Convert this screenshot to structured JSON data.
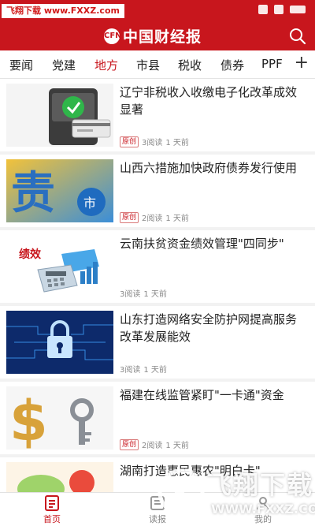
{
  "watermark": {
    "top_left": "飞翔下载 www.FXXZ.com",
    "brand": "飞翔下载",
    "domain": "WWW.FXXZ.COM"
  },
  "header": {
    "title": "中国财经报",
    "logo_mark": "CFN"
  },
  "tabs": [
    {
      "label": "要闻"
    },
    {
      "label": "党建"
    },
    {
      "label": "地方",
      "active": true
    },
    {
      "label": "市县"
    },
    {
      "label": "税收"
    },
    {
      "label": "债券"
    },
    {
      "label": "PPF"
    }
  ],
  "tabs_add": "+",
  "articles": [
    {
      "title": "辽宁非税收入收缴电子化改革成效显著",
      "badge": "原创",
      "reads": "3阅读",
      "time": "1 天前",
      "thumb": "check-card"
    },
    {
      "title": "山西六措施加快政府债券发行使用",
      "badge": "原创",
      "reads": "2阅读",
      "time": "1 天前",
      "thumb": "bond-market"
    },
    {
      "title": "云南扶贫资金绩效管理\"四同步\"",
      "badge": "",
      "reads": "3阅读",
      "time": "1 天前",
      "thumb": "calculator-chart",
      "thumb_text": "绩效"
    },
    {
      "title": "山东打造网络安全防护网提高服务改革发展能效",
      "badge": "",
      "reads": "3阅读",
      "time": "1 天前",
      "thumb": "security-lock"
    },
    {
      "title": "福建在线监管紧盯\"一卡通\"资金",
      "badge": "原创",
      "reads": "2阅读",
      "time": "1 天前",
      "thumb": "dollar-key"
    },
    {
      "title": "湖南打造惠民惠农\"明白卡\"",
      "badge": "",
      "reads": "",
      "time": "",
      "thumb": "cards"
    }
  ],
  "bottom_nav": [
    {
      "label": "首页",
      "icon": "home-doc-icon",
      "active": true
    },
    {
      "label": "读报",
      "icon": "newspaper-icon"
    },
    {
      "label": "我的",
      "icon": "profile-icon"
    }
  ],
  "colors": {
    "brand_red": "#c8161d",
    "text": "#222222",
    "meta": "#888888"
  }
}
